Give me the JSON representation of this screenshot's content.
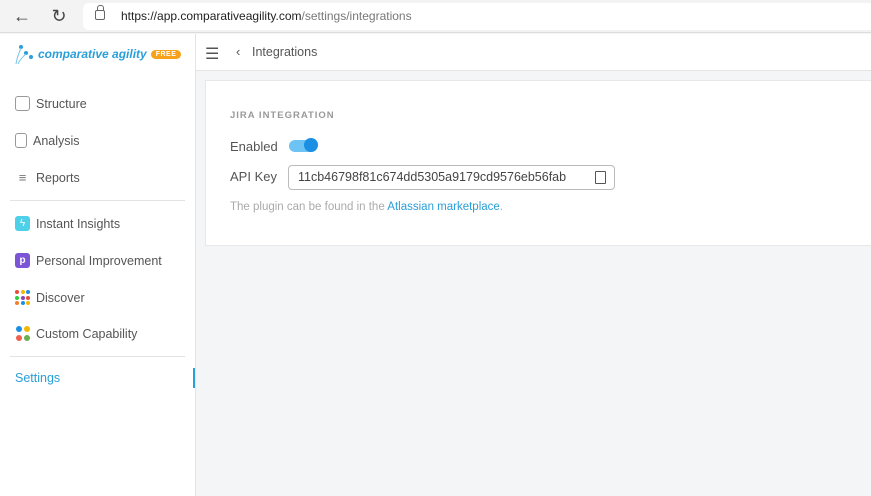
{
  "browser": {
    "url_domain": "https://app.comparativeagility.com",
    "url_path": "/settings/integrations"
  },
  "logo": {
    "text": "comparative agility",
    "badge": "FREE"
  },
  "sidebar": {
    "items": [
      {
        "label": "Structure"
      },
      {
        "label": "Analysis"
      },
      {
        "label": "Reports"
      },
      {
        "label": "Instant Insights"
      },
      {
        "label": "Personal Improvement"
      },
      {
        "label": "Discover"
      },
      {
        "label": "Custom Capability"
      },
      {
        "label": "Settings"
      }
    ]
  },
  "header": {
    "breadcrumb": "Integrations"
  },
  "jira": {
    "section_title": "JIRA INTEGRATION",
    "enabled_label": "Enabled",
    "enabled": true,
    "api_key_label": "API Key",
    "api_key": "11cb46798f81c674dd5305a9179cd9576eb56fab",
    "note_prefix": "The plugin can be found in the ",
    "note_link": "Atlassian marketplace",
    "note_suffix": "."
  },
  "colors": {
    "accent": "#2a9fd8",
    "badge": "#f7a21b"
  }
}
